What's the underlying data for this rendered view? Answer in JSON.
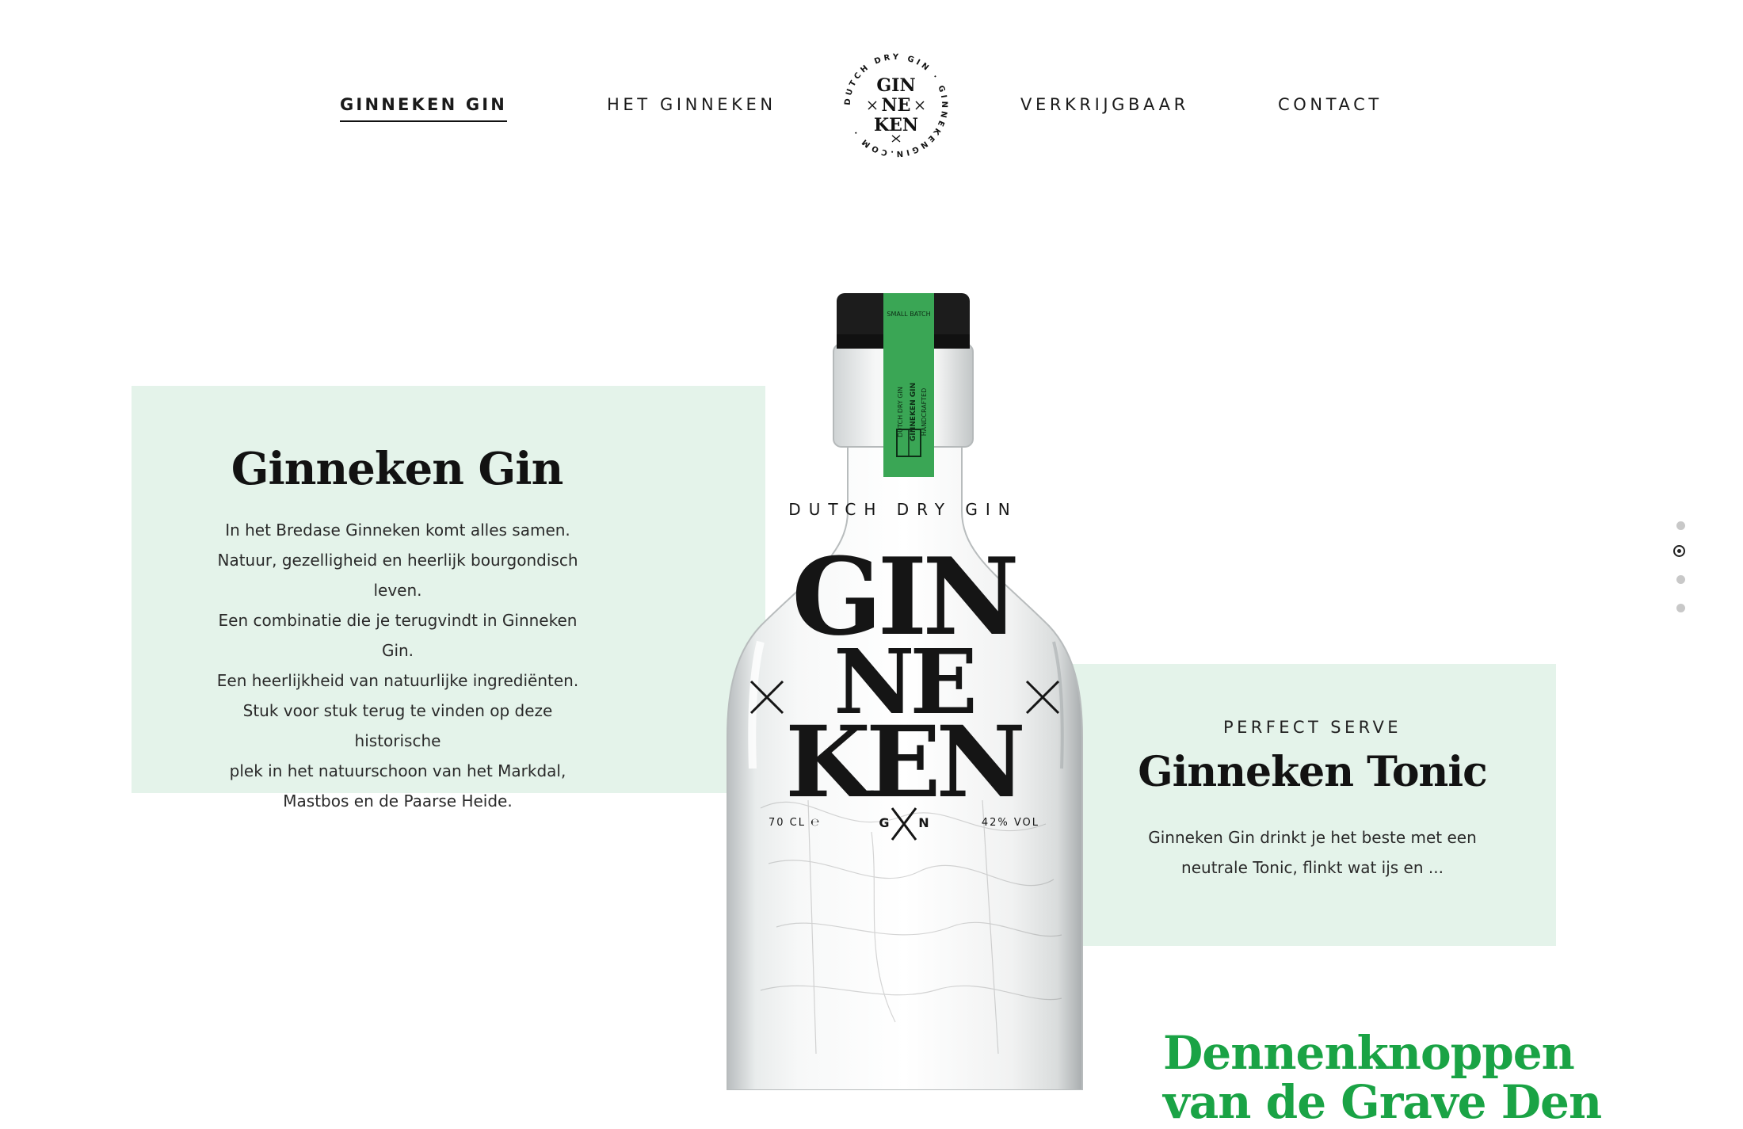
{
  "nav": {
    "items": [
      {
        "label": "GINNEKEN GIN",
        "active": true
      },
      {
        "label": "HET GINNEKEN",
        "active": false
      },
      {
        "label": "VERKRIJGBAAR",
        "active": false
      },
      {
        "label": "CONTACT",
        "active": false
      }
    ],
    "logo": {
      "ring_text": "DUTCH DRY GIN · GINNEKENGIN.COM ·",
      "line1": "GIN",
      "line2": "NE",
      "line3": "KEN"
    }
  },
  "intro": {
    "title": "Ginneken Gin",
    "lines": [
      "In het Bredase Ginneken komt alles samen.",
      "Natuur, gezelligheid en heerlijk bourgondisch leven.",
      "Een combinatie die je terugvindt in Ginneken Gin.",
      "Een heerlijkheid van natuurlijke ingrediënten.",
      "Stuk voor stuk terug te vinden op deze historische",
      "plek in het natuurschoon van het Markdal,",
      "Mastbos en de Paarse Heide."
    ]
  },
  "bottle": {
    "seal_top": "SMALL BATCH",
    "seal_line1": "DUTCH DRY GIN",
    "seal_line2": "GINNEKEN GIN",
    "seal_line3": "HANDCRAFTED",
    "label_top": "DUTCH DRY GIN",
    "label_l1": "GIN",
    "label_l2": "NE",
    "label_l3": "KEN",
    "volume": "70 CL ℮",
    "abv": "42% VOL",
    "mono_left": "G",
    "mono_right": "N"
  },
  "serve": {
    "kicker": "PERFECT SERVE",
    "title": "Ginneken Tonic",
    "lines": [
      "Ginneken Gin drinkt je het beste met een",
      "neutrale Tonic, flinkt wat ijs en ..."
    ]
  },
  "teaser": {
    "line1": "Dennenknoppen",
    "line2": "van de Grave Den"
  },
  "colors": {
    "panel": "#e4f3ea",
    "accent_green": "#1aa345",
    "seal_green": "#3aa655",
    "ink": "#121212"
  },
  "section_dots": {
    "count": 4,
    "active_index": 1
  }
}
